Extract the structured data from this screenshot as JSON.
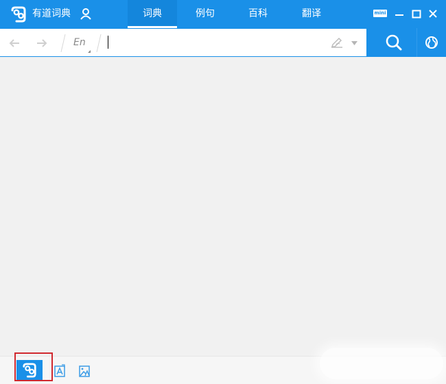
{
  "app": {
    "title": "有道词典"
  },
  "tabs": [
    {
      "label": "词典",
      "active": true
    },
    {
      "label": "例句",
      "active": false
    },
    {
      "label": "百科",
      "active": false
    },
    {
      "label": "翻译",
      "active": false
    }
  ],
  "window_controls": {
    "mini_label": "mini"
  },
  "search": {
    "lang_label": "En",
    "value": "",
    "placeholder": ""
  },
  "colors": {
    "primary": "#1a90e8",
    "active_tab": "#1486dc",
    "highlight_frame": "#d0282e"
  },
  "icons": [
    "youdao-logo",
    "user-icon",
    "back-arrow-icon",
    "forward-arrow-icon",
    "handwriting-pen-icon",
    "dropdown-arrow-icon",
    "search-icon",
    "globe-icon",
    "minimize-icon",
    "maximize-icon",
    "close-icon",
    "word-card-icon",
    "image-translate-icon"
  ]
}
